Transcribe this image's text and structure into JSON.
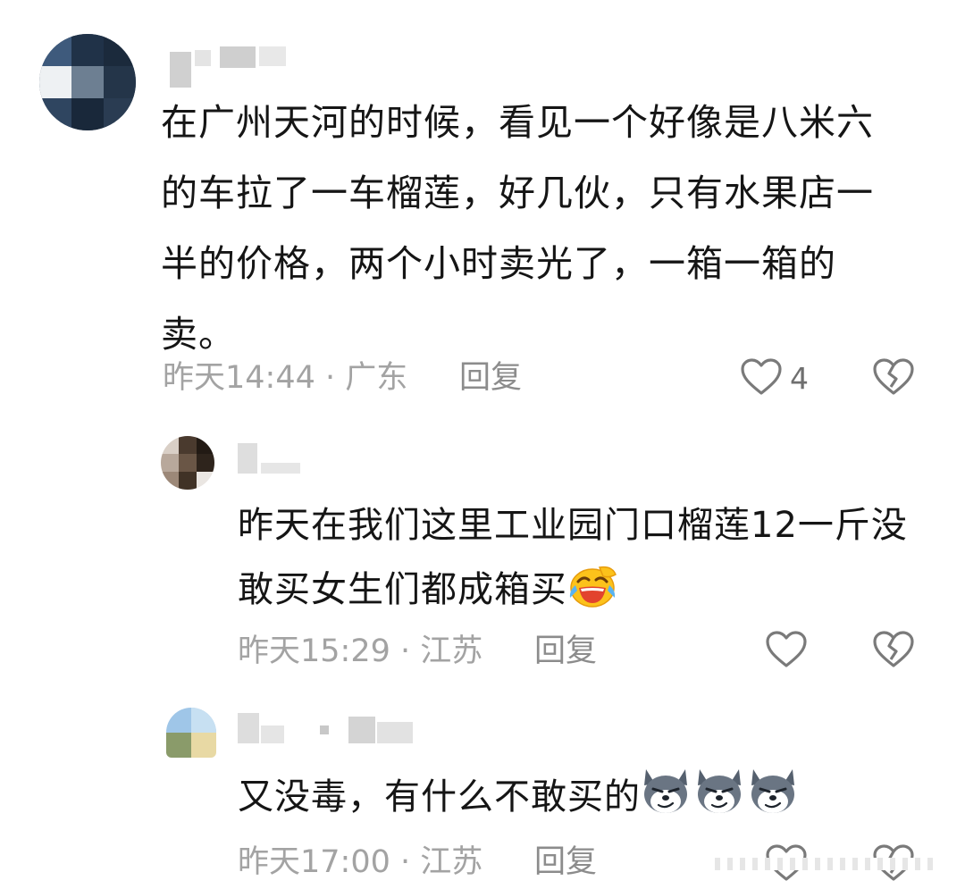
{
  "comments": [
    {
      "text": "在广州天河的时候，看见一个好像是八米六的车拉了一车榴莲，好几伙，只有水果店一半的价格，两个小时卖光了，一箱一箱的卖。",
      "time_location": "昨天14:44 · 广东",
      "reply_label": "回复",
      "like_count": "4"
    },
    {
      "text": "昨天在我们这里工业园门口榴莲12一斤没敢买女生们都成箱买",
      "emoji": "face-with-tears-of-joy",
      "time_location": "昨天15:29 · 江苏",
      "reply_label": "回复"
    },
    {
      "text": "又没毒，有什么不敢买的",
      "emoji": "smirking-husky",
      "time_location": "昨天17:00 · 江苏",
      "reply_label": "回复"
    }
  ],
  "colors": {
    "text": "#151515",
    "meta": "#a3a3a3",
    "icon": "#7a7a7a"
  }
}
